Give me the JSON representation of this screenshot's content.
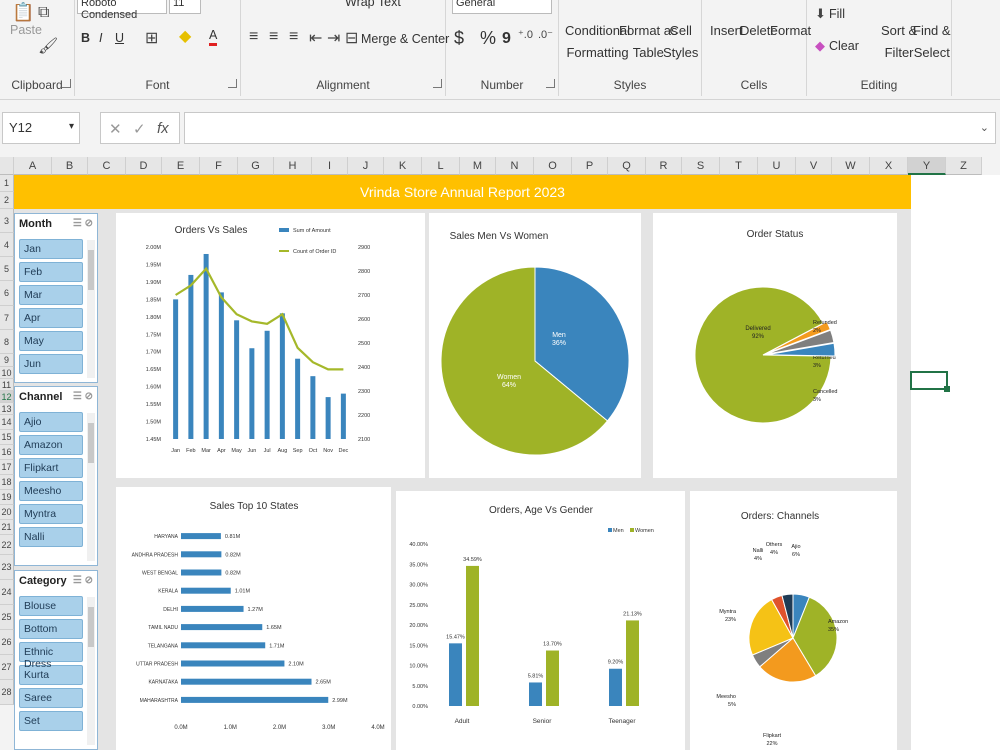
{
  "ribbon": {
    "clipboard": {
      "label": "Clipboard",
      "paste": "Paste"
    },
    "font": {
      "label": "Font",
      "name": "Roboto Condensed",
      "size": "11",
      "bold": "B",
      "italic": "I",
      "underline": "U"
    },
    "alignment": {
      "label": "Alignment",
      "wrap_text": "Wrap Text",
      "merge_center": "Merge & Center"
    },
    "number": {
      "label": "Number",
      "format": "General",
      "currency": "$",
      "percent": "%",
      "comma": "9"
    },
    "styles": {
      "label": "Styles",
      "conditional": [
        "Conditional",
        "Formatting"
      ],
      "format_table": [
        "Format as",
        "Table"
      ],
      "cell_styles": [
        "Cell",
        "Styles"
      ]
    },
    "cells": {
      "label": "Cells",
      "insert": "Insert",
      "delete": "Delete",
      "format": "Format"
    },
    "editing": {
      "label": "Editing",
      "fill": "Fill",
      "clear": "Clear",
      "sort": [
        "Sort &",
        "Filter"
      ],
      "find": [
        "Find &",
        "Select"
      ]
    }
  },
  "formula_bar": {
    "name_box": "Y12",
    "formula": ""
  },
  "columns": [
    "A",
    "B",
    "C",
    "D",
    "E",
    "F",
    "G",
    "H",
    "I",
    "J",
    "K",
    "L",
    "M",
    "N",
    "O",
    "P",
    "Q",
    "R",
    "S",
    "T",
    "U",
    "V",
    "W",
    "X",
    "Y",
    "Z"
  ],
  "rows": [
    "1",
    "2",
    "3",
    "4",
    "5",
    "6",
    "7",
    "8",
    "9",
    "10",
    "11",
    "12",
    "13",
    "14",
    "15",
    "16",
    "17",
    "18",
    "19",
    "20",
    "21",
    "22",
    "23",
    "24",
    "25",
    "26",
    "27",
    "28"
  ],
  "dashboard_title": "Vrinda Store Annual Report 2023",
  "slicers": {
    "month": {
      "title": "Month",
      "items": [
        "Jan",
        "Feb",
        "Mar",
        "Apr",
        "May",
        "Jun"
      ]
    },
    "channel": {
      "title": "Channel",
      "items": [
        "Ajio",
        "Amazon",
        "Flipkart",
        "Meesho",
        "Myntra",
        "Nalli"
      ]
    },
    "category": {
      "title": "Category",
      "items": [
        "Blouse",
        "Bottom",
        "Ethnic Dress",
        "Kurta",
        "Saree",
        "Set"
      ]
    }
  },
  "chart_data": [
    {
      "type": "bar",
      "title": "Orders Vs Sales",
      "categories": [
        "Jan",
        "Feb",
        "Mar",
        "Apr",
        "May",
        "Jun",
        "Jul",
        "Aug",
        "Sep",
        "Oct",
        "Nov",
        "Dec"
      ],
      "series": [
        {
          "name": "Sum of Amount",
          "kind": "bar",
          "axis": "left",
          "values": [
            1.85,
            1.92,
            1.98,
            1.87,
            1.79,
            1.71,
            1.76,
            1.81,
            1.68,
            1.63,
            1.57,
            1.58
          ]
        },
        {
          "name": "Count of Order ID",
          "kind": "line",
          "axis": "right",
          "values": [
            2700,
            2740,
            2810,
            2690,
            2620,
            2590,
            2580,
            2620,
            2480,
            2420,
            2390,
            2390
          ]
        }
      ],
      "y_left_ticks": [
        "2.00M",
        "1.95M",
        "1.90M",
        "1.85M",
        "1.80M",
        "1.75M",
        "1.70M",
        "1.65M",
        "1.60M",
        "1.55M",
        "1.50M",
        "1.45M"
      ],
      "y_left_range": [
        1.45,
        2.0
      ],
      "y_right_ticks": [
        "2900",
        "2800",
        "2700",
        "2600",
        "2500",
        "2400",
        "2300",
        "2200",
        "2100"
      ],
      "y_right_range": [
        2100,
        2900
      ],
      "colors": {
        "bar": "#3a85bd",
        "line": "#a5b82a"
      }
    },
    {
      "type": "pie",
      "title": "Sales Men Vs Women",
      "slices": [
        {
          "label": "Men",
          "pct_label": "36%",
          "value": 36,
          "color": "#3a85bd"
        },
        {
          "label": "Women",
          "pct_label": "64%",
          "value": 64,
          "color": "#9fb327"
        }
      ]
    },
    {
      "type": "pie",
      "title": "Order Status",
      "slices": [
        {
          "label": "Delivered",
          "pct_label": "92%",
          "value": 92,
          "color": "#9fb327"
        },
        {
          "label": "Refunded",
          "pct_label": "2%",
          "value": 2,
          "color": "#f39a1e"
        },
        {
          "label": "Returned",
          "pct_label": "3%",
          "value": 3,
          "color": "#7f7f7f"
        },
        {
          "label": "Cancelled",
          "pct_label": "3%",
          "value": 3,
          "color": "#3a85bd"
        }
      ]
    },
    {
      "type": "bar",
      "orientation": "horizontal",
      "title": "Sales Top 10 States",
      "categories": [
        "HARYANA",
        "ANDHRA PRADESH",
        "WEST BENGAL",
        "KERALA",
        "DELHI",
        "TAMIL NADU",
        "TELANGANA",
        "UTTAR PRADESH",
        "KARNATAKA",
        "MAHARASHTRA"
      ],
      "values": [
        0.81,
        0.82,
        0.82,
        1.01,
        1.27,
        1.65,
        1.71,
        2.1,
        2.65,
        2.99
      ],
      "value_labels": [
        "0.81M",
        "0.82M",
        "0.82M",
        "1.01M",
        "1.27M",
        "1.65M",
        "1.71M",
        "2.10M",
        "2.65M",
        "2.99M"
      ],
      "x_ticks": [
        "0.0M",
        "1.0M",
        "2.0M",
        "3.0M",
        "4.0M"
      ],
      "xlim": [
        0,
        4
      ],
      "color": "#3a85bd"
    },
    {
      "type": "bar",
      "title": "Orders, Age Vs Gender",
      "categories": [
        "Adult",
        "Senior",
        "Teenager"
      ],
      "series": [
        {
          "name": "Men",
          "values": [
            15.47,
            5.81,
            9.2
          ],
          "labels": [
            "15.47%",
            "5.81%",
            "9.20%"
          ],
          "color": "#3a85bd"
        },
        {
          "name": "Women",
          "values": [
            34.59,
            13.7,
            21.13
          ],
          "labels": [
            "34.59%",
            "13.70%",
            "21.13%"
          ],
          "color": "#9fb327"
        }
      ],
      "y_ticks": [
        "40.00%",
        "35.00%",
        "30.00%",
        "25.00%",
        "20.00%",
        "15.00%",
        "10.00%",
        "5.00%",
        "0.00%"
      ],
      "ylim": [
        0,
        40
      ]
    },
    {
      "type": "pie",
      "title": "Orders: Channels",
      "slices": [
        {
          "label": "Ajio",
          "pct_label": "6%",
          "value": 6,
          "color": "#3a85bd"
        },
        {
          "label": "Amazon",
          "pct_label": "35%",
          "value": 35,
          "color": "#9fb327"
        },
        {
          "label": "Flipkart",
          "pct_label": "22%",
          "value": 22,
          "color": "#f39a1e"
        },
        {
          "label": "Meesho",
          "pct_label": "5%",
          "value": 5,
          "color": "#7f7f7f"
        },
        {
          "label": "Myntra",
          "pct_label": "23%",
          "value": 23,
          "color": "#f5c216"
        },
        {
          "label": "Nalli",
          "pct_label": "4%",
          "value": 4,
          "color": "#e0532c"
        },
        {
          "label": "Others",
          "pct_label": "4%",
          "value": 4,
          "color": "#1f3b55"
        }
      ]
    }
  ]
}
